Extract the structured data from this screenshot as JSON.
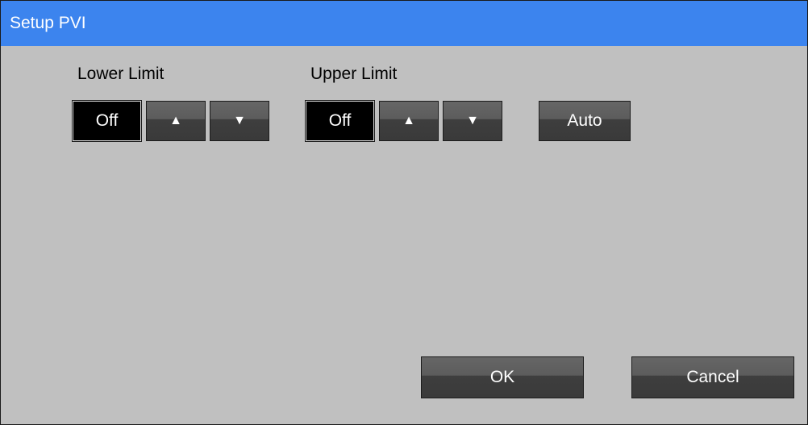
{
  "dialog": {
    "title": "Setup PVI"
  },
  "lower_limit": {
    "label": "Lower Limit",
    "value": "Off",
    "up_glyph": "▲",
    "down_glyph": "▼"
  },
  "upper_limit": {
    "label": "Upper Limit",
    "value": "Off",
    "up_glyph": "▲",
    "down_glyph": "▼"
  },
  "auto_label": "Auto",
  "footer": {
    "ok_label": "OK",
    "cancel_label": "Cancel"
  },
  "colors": {
    "titlebar": "#3c84ee",
    "background": "#c0c0c0",
    "button": "#4a4a4a",
    "value_box": "#000000"
  }
}
